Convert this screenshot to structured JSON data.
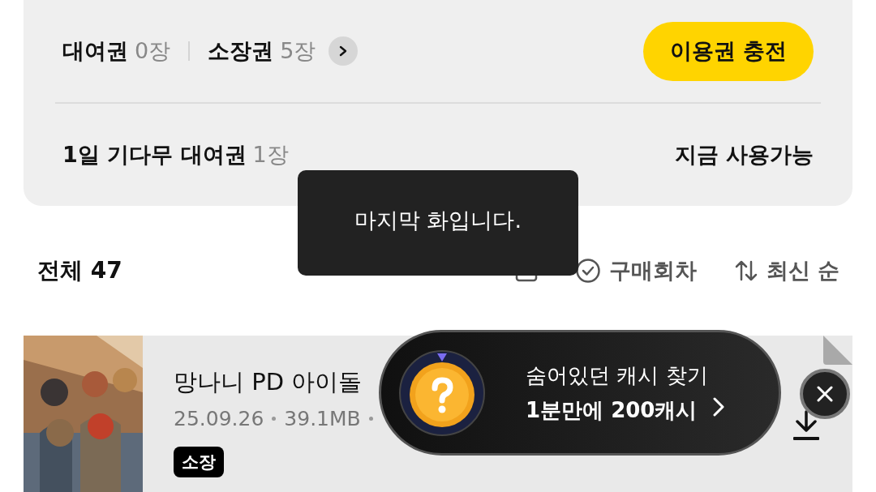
{
  "tickets": [
    {
      "label": "대여권",
      "count": "0장"
    },
    {
      "label": "소장권",
      "count": "5장"
    }
  ],
  "charge_button": "이용권 충전",
  "wait_ticket": {
    "label": "1일 기다무 대여권",
    "count": "1장",
    "status": "지금 사용가능"
  },
  "toast": "마지막 화입니다.",
  "total": "전체 47",
  "filters": [
    {
      "kind": "checkbox"
    },
    {
      "kind": "check",
      "label": "구매회차"
    },
    {
      "kind": "sort",
      "label": "최신 순"
    }
  ],
  "episodes": [
    {
      "title": "망나니 PD 아이돌",
      "date": "25.09.26",
      "size": "39.1MB",
      "badge": "소장"
    }
  ],
  "promo": {
    "line1": "숨어있던 캐시 찾기",
    "line2": "1분만에 200캐시"
  }
}
